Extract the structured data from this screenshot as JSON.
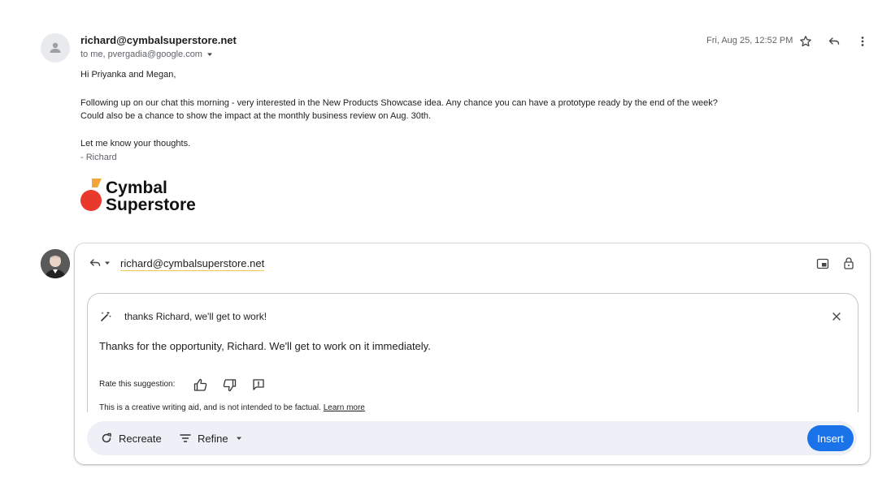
{
  "email": {
    "sender": "richard@cymbalsuperstore.net",
    "recipients": "to me, pvergadia@google.com",
    "date": "Fri, Aug 25, 12:52 PM",
    "greeting": "Hi Priyanka and Megan,",
    "paragraph_line1": "Following up on our chat this morning - very interested in the New Products Showcase idea. Any chance you can have a prototype ready by the end of the week?",
    "paragraph_line2": "Could also be a chance to show the impact at the monthly business review on Aug. 30th.",
    "closing": "Let me know your thoughts.",
    "signature": "- Richard",
    "logo_line1": "Cymbal",
    "logo_line2": "Superstore"
  },
  "reply": {
    "to": "richard@cymbalsuperstore.net",
    "prompt": "thanks Richard, we'll get to work!",
    "suggestion": "Thanks for the opportunity, Richard. We'll get to work on it immediately.",
    "rate_label": "Rate this suggestion:",
    "disclaimer": "This is a creative writing aid, and is not intended to be factual.",
    "learn_more": "Learn more",
    "recreate_label": "Recreate",
    "refine_label": "Refine",
    "insert_label": "Insert"
  },
  "colors": {
    "accent": "#1a73e8",
    "logo_orange": "#f4a43a",
    "logo_red": "#e8392c"
  }
}
